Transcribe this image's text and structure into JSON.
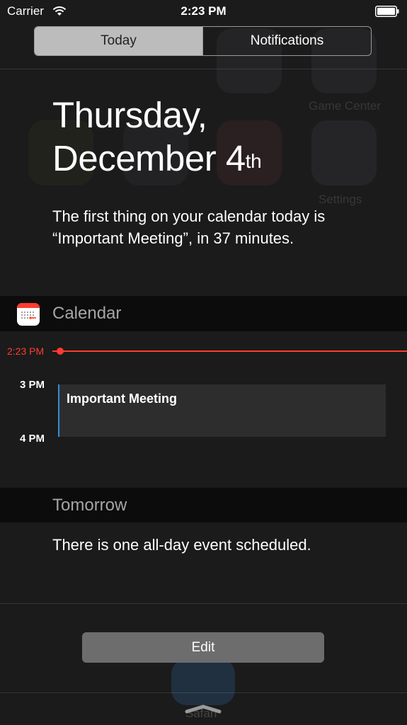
{
  "status_bar": {
    "carrier": "Carrier",
    "time": "2:23 PM"
  },
  "tabs": [
    {
      "label": "Today",
      "active": true
    },
    {
      "label": "Notifications",
      "active": false
    }
  ],
  "today": {
    "weekday": "Thursday,",
    "date": "December 4",
    "date_suffix": "th",
    "summary": "The first thing on your calendar today is “Important Meeting”, in 37 minutes."
  },
  "calendar": {
    "title": "Calendar",
    "now_label": "2:23 PM",
    "hours": [
      "3 PM",
      "4 PM"
    ],
    "event": {
      "title": "Important Meeting"
    }
  },
  "tomorrow": {
    "title": "Tomorrow",
    "text": "There is one all-day event scheduled."
  },
  "edit_label": "Edit",
  "background": {
    "dock_label": "Safari",
    "ghost_label": "Game Center",
    "ghost_label2": "Settings"
  },
  "colors": {
    "accent_red": "#ff3b30",
    "event_blue": "#2f8fd6"
  }
}
